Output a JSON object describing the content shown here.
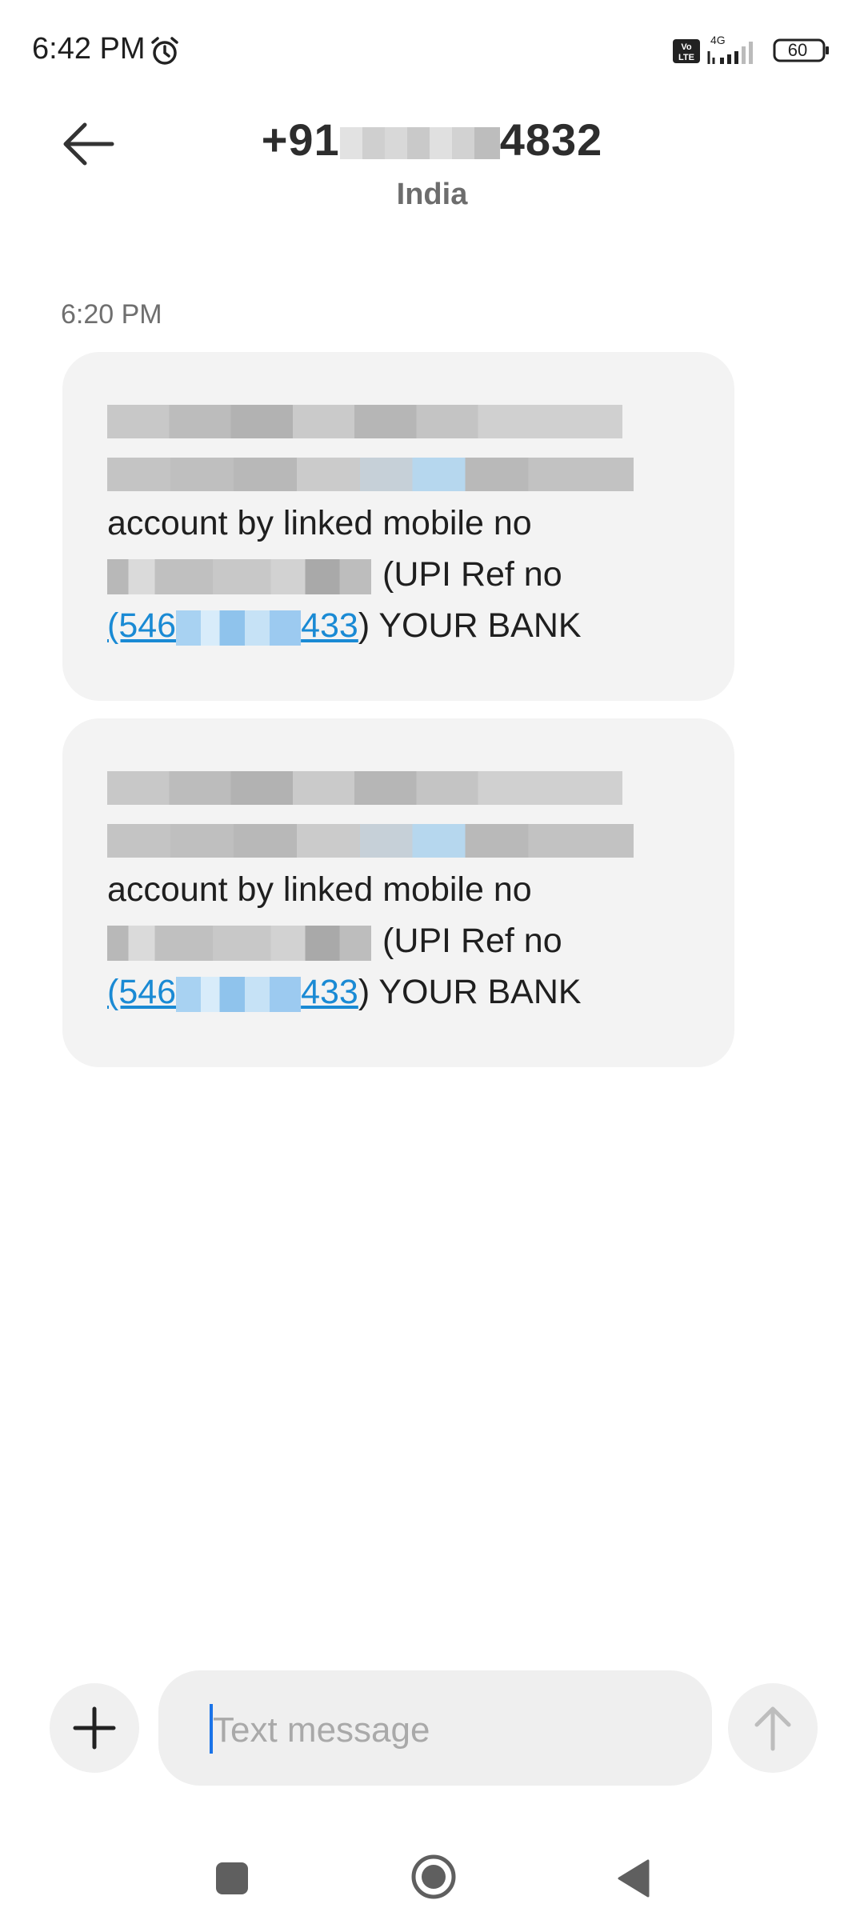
{
  "status_bar": {
    "time": "6:42 PM",
    "battery": "60",
    "network": "4G",
    "icons": [
      "alarm-icon",
      "volte-icon",
      "signal-icon",
      "battery-icon"
    ]
  },
  "header": {
    "contact_prefix": "+91",
    "contact_suffix": "4832",
    "region": "India",
    "icons": [
      "back-arrow-icon"
    ]
  },
  "conversation": {
    "timestamp": "6:20 PM",
    "messages": [
      {
        "line3": "account by linked mobile no",
        "ref_label": "(UPI Ref no",
        "ref_prefix": "(546",
        "ref_suffix": "433",
        "tail": ") YOUR BANK"
      },
      {
        "line3": "account by linked mobile no",
        "ref_label": "(UPI Ref no",
        "ref_prefix": "(546",
        "ref_suffix": "433",
        "tail": ") YOUR BANK"
      }
    ]
  },
  "composer": {
    "placeholder": "Text message",
    "icons": [
      "plus-icon",
      "send-arrow-icon"
    ]
  },
  "nav_bar": {
    "icons": [
      "recent-apps-icon",
      "home-icon",
      "back-triangle-icon"
    ]
  },
  "colors": {
    "link": "#1a8ad4",
    "bubble": "#f3f3f3",
    "cursor": "#1a73e8"
  }
}
